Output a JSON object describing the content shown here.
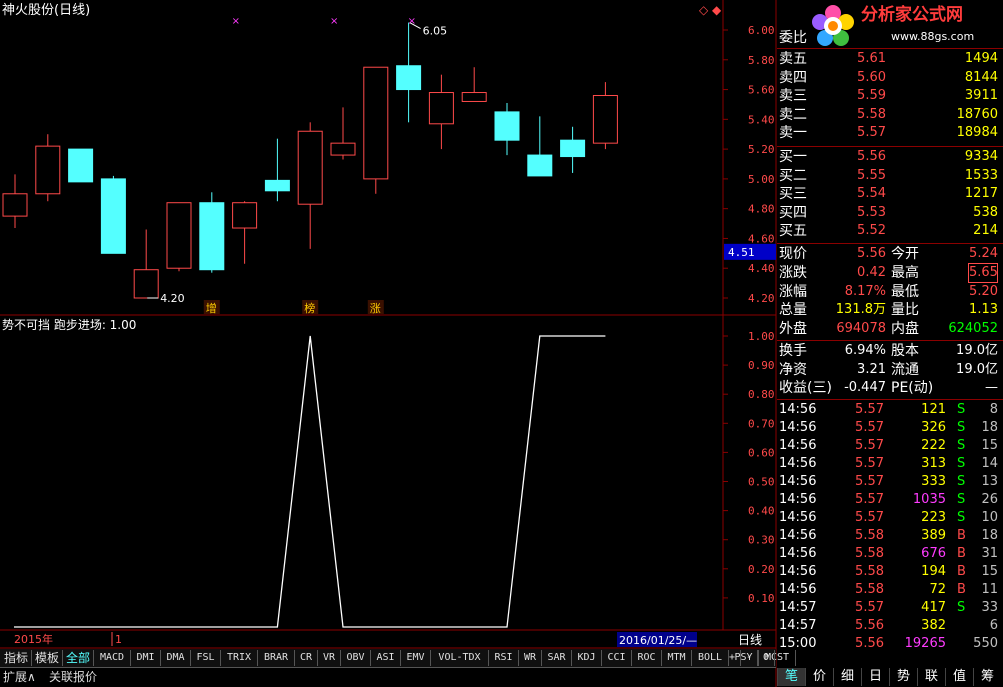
{
  "title": "神火股份(日线)",
  "indicator_label": "势不可挡 跑步进场: 1.00",
  "icons": {
    "diamond": "◇",
    "box": "◆"
  },
  "colors": {
    "up": "#ff4a4a",
    "down": "#54ffff",
    "grid": "#8b0000",
    "text": "#c0c0c0",
    "white": "#ffffff",
    "yellow": "#ffff00",
    "green": "#00ff00",
    "magenta": "#ff3cff"
  },
  "price_axis": [
    "6.00",
    "5.80",
    "5.60",
    "5.40",
    "5.20",
    "5.00",
    "4.80",
    "4.60",
    "4.40",
    "4.20"
  ],
  "current_price_tag": "4.51",
  "indicator_axis": [
    "1.00",
    "0.90",
    "0.80",
    "0.70",
    "0.60",
    "0.50",
    "0.40",
    "0.30",
    "0.20",
    "0.10"
  ],
  "markers": [
    {
      "label": "增"
    },
    {
      "label": "榜"
    },
    {
      "label": "涨"
    }
  ],
  "annotations": {
    "high": "6.05",
    "low": "4.20"
  },
  "x_axis": {
    "year": "2015年",
    "mark": "1",
    "date": "2016/01/25/—",
    "period": "日线"
  },
  "chart_data": {
    "type": "candlestick",
    "ylim": [
      4.15,
      6.1
    ],
    "candles": [
      {
        "o": 4.75,
        "c": 4.9,
        "h": 5.03,
        "l": 4.67
      },
      {
        "o": 4.9,
        "c": 5.22,
        "h": 5.3,
        "l": 4.85
      },
      {
        "o": 5.2,
        "c": 4.98,
        "h": 5.2,
        "l": 4.98
      },
      {
        "o": 5.0,
        "c": 4.5,
        "h": 5.02,
        "l": 4.5
      },
      {
        "o": 4.2,
        "c": 4.39,
        "h": 4.66,
        "l": 4.2
      },
      {
        "o": 4.4,
        "c": 4.84,
        "h": 4.84,
        "l": 4.38
      },
      {
        "o": 4.84,
        "c": 4.39,
        "h": 4.91,
        "l": 4.37
      },
      {
        "o": 4.67,
        "c": 4.84,
        "h": 4.85,
        "l": 4.43
      },
      {
        "o": 4.99,
        "c": 4.92,
        "h": 5.27,
        "l": 4.85
      },
      {
        "o": 4.83,
        "c": 5.32,
        "h": 5.38,
        "l": 4.53
      },
      {
        "o": 5.16,
        "c": 5.24,
        "h": 5.48,
        "l": 5.13
      },
      {
        "o": 5.0,
        "c": 5.75,
        "h": 5.75,
        "l": 4.9
      },
      {
        "o": 5.76,
        "c": 5.6,
        "h": 6.05,
        "l": 5.38
      },
      {
        "o": 5.37,
        "c": 5.58,
        "h": 5.7,
        "l": 5.2
      },
      {
        "o": 5.52,
        "c": 5.58,
        "h": 5.75,
        "l": 5.52
      },
      {
        "o": 5.45,
        "c": 5.26,
        "h": 5.51,
        "l": 5.16
      },
      {
        "o": 5.16,
        "c": 5.02,
        "h": 5.42,
        "l": 5.02
      },
      {
        "o": 5.26,
        "c": 5.15,
        "h": 5.35,
        "l": 5.04
      },
      {
        "o": 5.24,
        "c": 5.56,
        "h": 5.65,
        "l": 5.2
      }
    ],
    "indicator": [
      0,
      0,
      0,
      0,
      0,
      0,
      0,
      0,
      0,
      1,
      0,
      0,
      0,
      0,
      0,
      0,
      1,
      1,
      1
    ]
  },
  "quote": {
    "weibi_label": "委比",
    "asks": [
      {
        "label": "卖五",
        "price": "5.61",
        "vol": "1494"
      },
      {
        "label": "卖四",
        "price": "5.60",
        "vol": "8144"
      },
      {
        "label": "卖三",
        "price": "5.59",
        "vol": "3911"
      },
      {
        "label": "卖二",
        "price": "5.58",
        "vol": "18760"
      },
      {
        "label": "卖一",
        "price": "5.57",
        "vol": "18984"
      }
    ],
    "bids": [
      {
        "label": "买一",
        "price": "5.56",
        "vol": "9334"
      },
      {
        "label": "买二",
        "price": "5.55",
        "vol": "1533"
      },
      {
        "label": "买三",
        "price": "5.54",
        "vol": "1217"
      },
      {
        "label": "买四",
        "price": "5.53",
        "vol": "538"
      },
      {
        "label": "买五",
        "price": "5.52",
        "vol": "214"
      }
    ],
    "stats": [
      {
        "l1": "现价",
        "v1": "5.56",
        "l2": "今开",
        "v2": "5.24"
      },
      {
        "l1": "涨跌",
        "v1": "0.42",
        "l2": "最高",
        "v2": "5.65"
      },
      {
        "l1": "涨幅",
        "v1": "8.17%",
        "l2": "最低",
        "v2": "5.20"
      },
      {
        "l1": "总量",
        "v1": "131.8万",
        "l2": "量比",
        "v2": "1.13"
      },
      {
        "l1": "外盘",
        "v1": "694078",
        "l2": "内盘",
        "v2": "624052"
      }
    ],
    "stats2": [
      {
        "l1": "换手",
        "v1": "6.94%",
        "l2": "股本",
        "v2": "19.0亿"
      },
      {
        "l1": "净资",
        "v1": "3.21",
        "l2": "流通",
        "v2": "19.0亿"
      },
      {
        "l1": "收益(三)",
        "v1": "-0.447",
        "l2": "PE(动)",
        "v2": "—"
      }
    ],
    "ticks": [
      {
        "t": "14:56",
        "p": "5.57",
        "v": "121",
        "d": "S",
        "n": "8"
      },
      {
        "t": "14:56",
        "p": "5.57",
        "v": "326",
        "d": "S",
        "n": "18"
      },
      {
        "t": "14:56",
        "p": "5.57",
        "v": "222",
        "d": "S",
        "n": "15"
      },
      {
        "t": "14:56",
        "p": "5.57",
        "v": "313",
        "d": "S",
        "n": "14"
      },
      {
        "t": "14:56",
        "p": "5.57",
        "v": "333",
        "d": "S",
        "n": "13"
      },
      {
        "t": "14:56",
        "p": "5.57",
        "v": "1035",
        "d": "S",
        "n": "26"
      },
      {
        "t": "14:56",
        "p": "5.57",
        "v": "223",
        "d": "S",
        "n": "10"
      },
      {
        "t": "14:56",
        "p": "5.58",
        "v": "389",
        "d": "B",
        "n": "18"
      },
      {
        "t": "14:56",
        "p": "5.58",
        "v": "676",
        "d": "B",
        "n": "31"
      },
      {
        "t": "14:56",
        "p": "5.58",
        "v": "194",
        "d": "B",
        "n": "15"
      },
      {
        "t": "14:56",
        "p": "5.58",
        "v": "72",
        "d": "B",
        "n": "11"
      },
      {
        "t": "14:57",
        "p": "5.57",
        "v": "417",
        "d": "S",
        "n": "33"
      },
      {
        "t": "14:57",
        "p": "5.56",
        "v": "382",
        "d": "",
        "n": "6"
      },
      {
        "t": "15:00",
        "p": "5.56",
        "v": "19265",
        "d": "",
        "n": "550"
      }
    ]
  },
  "logo": {
    "text": "分析家公式网",
    "url": "www.88gs.com"
  },
  "tabs": [
    "指标",
    "模板",
    "全部",
    "MACD",
    "DMI",
    "DMA",
    "FSL",
    "TRIX",
    "BRAR",
    "CR",
    "VR",
    "OBV",
    "ASI",
    "EMV",
    "VOL-TDX",
    "RSI",
    "WR",
    "SAR",
    "KDJ",
    "CCI",
    "ROC",
    "MTM",
    "BOLL",
    "PSY",
    "MCST"
  ],
  "tab_controls": [
    "+",
    "-",
    "0"
  ],
  "bottom_buttons": [
    "扩展∧",
    "关联报价"
  ],
  "side_tabs": [
    "笔",
    "价",
    "细",
    "日",
    "势",
    "联",
    "值",
    "筹"
  ]
}
